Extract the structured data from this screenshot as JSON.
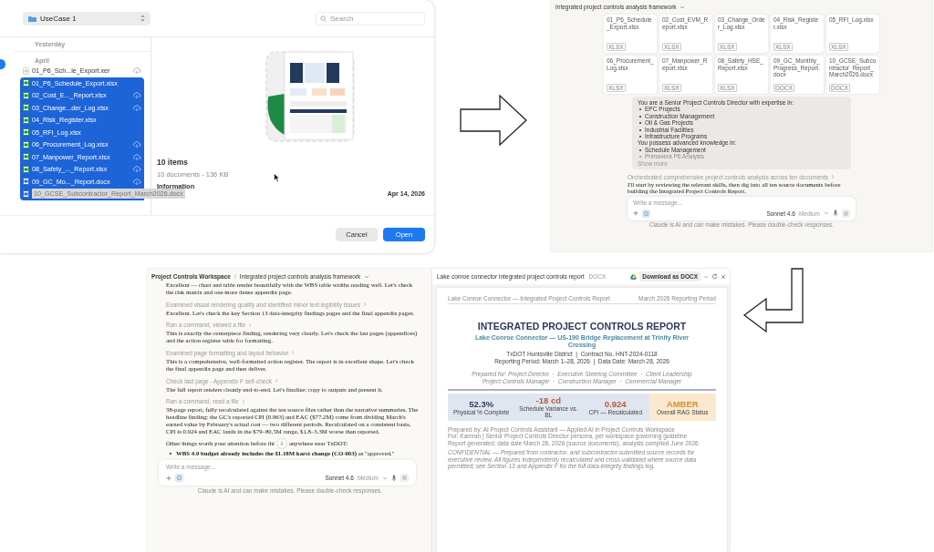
{
  "file_dialog": {
    "location": "UseCase 1",
    "search_placeholder": "Search",
    "group_labels": [
      "Yesterday",
      "April"
    ],
    "files": [
      {
        "name": "01_P6_Sch...le_Export.xer",
        "kind": "xer",
        "cloud": true,
        "selected": false
      },
      {
        "name": "01_P6_Schedule_Export.xlsx",
        "kind": "xlsx",
        "cloud": false,
        "selected": true
      },
      {
        "name": "02_Cost_E..._Report.xlsx",
        "kind": "xlsx",
        "cloud": true,
        "selected": true
      },
      {
        "name": "03_Change...der_Log.xlsx",
        "kind": "xlsx",
        "cloud": true,
        "selected": true
      },
      {
        "name": "04_Risk_Register.xlsx",
        "kind": "xlsx",
        "cloud": false,
        "selected": true
      },
      {
        "name": "05_RFI_Log.xlsx",
        "kind": "xlsx",
        "cloud": false,
        "selected": true
      },
      {
        "name": "06_Procurement_Log.xlsx",
        "kind": "xlsx",
        "cloud": true,
        "selected": true
      },
      {
        "name": "07_Manpower_Report.xlsx",
        "kind": "xlsx",
        "cloud": true,
        "selected": true
      },
      {
        "name": "08_Safety_..._Report.xlsx",
        "kind": "xlsx",
        "cloud": true,
        "selected": true
      },
      {
        "name": "09_GC_Mo..._Report.docx",
        "kind": "docx",
        "cloud": true,
        "selected": true
      },
      {
        "name": "10_GCSE_Subcontractor_Report_March2026.docx",
        "kind": "docx",
        "cloud": false,
        "selected": true
      }
    ],
    "preview": {
      "count": "10 items",
      "summary": "10 documents - 136 KB",
      "section": "Information",
      "date": "Apr 14, 2026"
    },
    "buttons": [
      {
        "label": "Cancel",
        "kind": "secondary"
      },
      {
        "label": "Open",
        "kind": "primary"
      }
    ]
  },
  "chat_overview": {
    "title": "Integrated project controls analysis framework",
    "attachments": [
      {
        "name": "01_P6_Schedule_Export.xlsx",
        "type": "XLSX"
      },
      {
        "name": "02_Cost_EVM_Report.xlsx",
        "type": "XLSX"
      },
      {
        "name": "03_Change_Order_Log.xlsx",
        "type": "XLSX"
      },
      {
        "name": "04_Risk_Register.xlsx",
        "type": "XLSX"
      },
      {
        "name": "05_RFI_Log.xlsx",
        "type": "XLSX"
      },
      {
        "name": "06_Procurement_Log.xlsx",
        "type": "XLSX"
      },
      {
        "name": "07_Manpower_Report.xlsx",
        "type": "XLSX"
      },
      {
        "name": "08_Safety_HSE_Report.xlsx",
        "type": "XLSX"
      },
      {
        "name": "09_GC_Monthly_Progress_Report.docx",
        "type": "DOCX"
      },
      {
        "name": "10_GCSE_Subcontractor_Report_March2026.docx",
        "type": "DOCX"
      }
    ],
    "prompt": [
      {
        "kind": "heading",
        "text": "You are a Senior Project Controls Director with expertise in:"
      },
      {
        "kind": "bullet",
        "text": "EPC Projects"
      },
      {
        "kind": "bullet",
        "text": "Construction Management"
      },
      {
        "kind": "bullet",
        "text": "Oil & Gas Projects"
      },
      {
        "kind": "bullet",
        "text": "Industrial Facilities"
      },
      {
        "kind": "bullet",
        "text": "Infrastructure Programs"
      },
      {
        "kind": "heading",
        "text": "You possess advanced knowledge in:"
      },
      {
        "kind": "bullet",
        "text": "Schedule Management"
      },
      {
        "kind": "faded",
        "text": "Primavera P6 Analysis"
      }
    ],
    "show_more": "Show more",
    "thinking": "Orchestrated comprehensive project controls analysis across ten documents",
    "reply": "I'll start by reviewing the relevant skills, then dig into all ten source documents before building the Integrated Project Controls Report.",
    "composer": {
      "placeholder": "Write a message...",
      "model": "Sonnet 4.6",
      "effort": "Medium"
    },
    "disclaimer": "Claude is AI and can make mistakes. Please double-check responses."
  },
  "chat_detail": {
    "breadcrumb": [
      "Project Controls Workspace",
      "/",
      "Integrated project controls analysis framework"
    ],
    "messages": [
      {
        "kind": "text",
        "text": "Excellent — chart and table render beautifully with the WBS table widths reading well. Let's check the risk matrix and one more dense appendix page."
      },
      {
        "kind": "step",
        "text": "Examined visual rendering quality and identified minor text legibility issues"
      },
      {
        "kind": "text",
        "text": "Excellent. Let's check the key Section 13 data-integrity findings pages and the final appendix pages."
      },
      {
        "kind": "step",
        "text": "Ran a command, viewed a file"
      },
      {
        "kind": "text",
        "text": "This is exactly the centerpiece finding, rendering very clearly. Let's check the last pages (appendices) and the action register table for formatting."
      },
      {
        "kind": "step",
        "text": "Examined page formatting and layout behavior"
      },
      {
        "kind": "text",
        "text": "This is a comprehensive, well-formatted action register. The report is in excellent shape. Let's check the final appendix page and then deliver."
      },
      {
        "kind": "step",
        "text": "Check last page - Appendix F self-check"
      },
      {
        "kind": "text",
        "text": "The full report renders cleanly end-to-end. Let's finalize: copy to outputs and present it."
      },
      {
        "kind": "step",
        "text": "Ran a command, read a file"
      },
      {
        "kind": "text",
        "text": "38-page report, fully recalculated against the ten source files rather than the narrative summaries. The headline finding: the GC's reported CPI (0.963) and EAC ($77.2M) come from dividing March's earned value by February's actual cost — two different periods. Recalculated on a consistent basis, CPI is 0.924 and EAC lands in the $79–80.5M range, $1.8–3.3M worse than reported."
      },
      {
        "kind": "interrupted",
        "text": "Other things worth your attention before thi",
        "rest": "anywhere near TxDOT:"
      },
      {
        "kind": "bullet",
        "text": "**WBS 4.0 budget already includes the $1.18M karst change (CO-003)** as \"approved.\""
      }
    ],
    "composer": {
      "placeholder": "Write a message...",
      "model": "Sonnet 4.6",
      "effort": "Medium"
    },
    "disclaimer": "Claude is AI and can make mistakes. Please double-check responses."
  },
  "document_viewer": {
    "title": "Lake conroe connector integrated project controls report",
    "format": "DOCX",
    "download": "Download as DOCX",
    "report": {
      "header_left": "Lake Conroe Connector — Integrated Project Controls Report",
      "header_right": "March 2026 Reporting Period",
      "title": "INTEGRATED PROJECT CONTROLS REPORT",
      "subtitle": "Lake Conroe Connector — US-190 Bridge Replacement at Trinity River Crossing",
      "details": [
        "TxDOT Huntsville District  |  Contract No. HNT-2024-0118",
        "Reporting Period: March 1–28, 2026  |  Data Date: March 28, 2026"
      ],
      "prepared_for": [
        "Prepared for: Project Director  ·  Executive Steering Committee  ·  Client Leadership",
        "Project Controls Manager  ·  Construction Manager  ·  Commercial Manager"
      ],
      "kpis": [
        {
          "value": "52.3%",
          "label": "Physical % Complete",
          "kind": "metric",
          "color": "#2f3f5c"
        },
        {
          "value": "-18 cd",
          "label": "Schedule Variance vs. BL",
          "kind": "metric",
          "color": "#c4553f"
        },
        {
          "value": "0.924",
          "label": "CPI — Recalculated",
          "kind": "metric",
          "color": "#c4553f"
        },
        {
          "value": "AMBER",
          "label": "Overall RAG Status",
          "kind": "status",
          "color": "#d9902f"
        }
      ],
      "prepared_by": [
        "Prepared by: AI Project Controls Assistant — Applied AI in Project Controls Workspace",
        "For: Kamran  |  Senior Project Controls Director persona, per workspace governing guideline",
        "Report generated: data date March 28, 2026 (source documents); analysis compiled June 2026"
      ],
      "confidential": "CONFIDENTIAL — Prepared from contractor- and subcontractor-submitted source records for executive review. All figures independently recalculated and cross-validated where source data permitted; see Section 13 and Appendix F for the full data-integrity findings log."
    }
  }
}
